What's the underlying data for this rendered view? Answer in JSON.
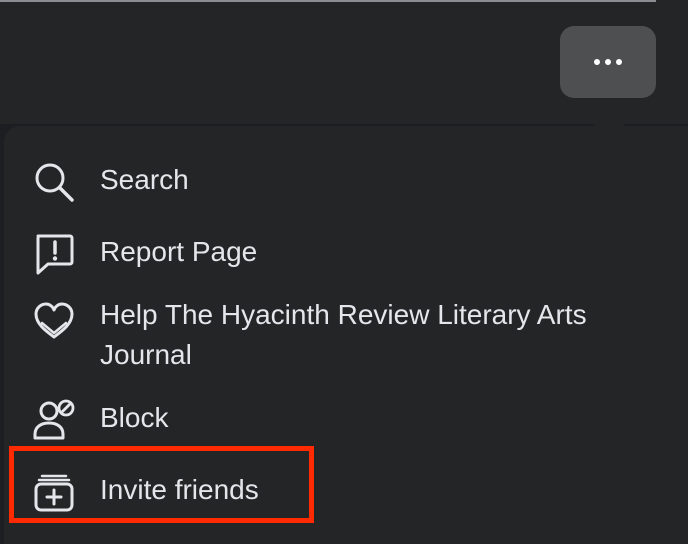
{
  "more_button": {
    "icon": "ellipsis-icon"
  },
  "menu": {
    "items": [
      {
        "label": "Search",
        "icon": "search-icon"
      },
      {
        "label": "Report Page",
        "icon": "report-icon"
      },
      {
        "label": "Help The Hyacinth Review Literary Arts Journal",
        "icon": "heart-hands-icon"
      },
      {
        "label": "Block",
        "icon": "block-user-icon"
      },
      {
        "label": "Invite friends",
        "icon": "invite-friends-icon"
      }
    ]
  },
  "colors": {
    "background": "#242526",
    "text": "#e4e6eb",
    "highlight": "#ff2a00",
    "button": "#4e4f50"
  }
}
